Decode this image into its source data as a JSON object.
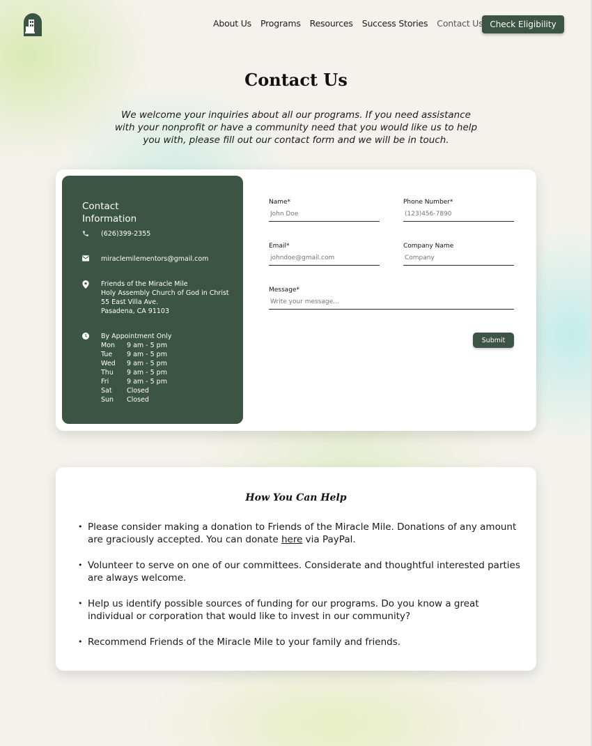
{
  "nav": {
    "items": [
      {
        "label": "About Us",
        "active": false
      },
      {
        "label": "Programs",
        "active": false
      },
      {
        "label": "Resources",
        "active": false
      },
      {
        "label": "Success Stories",
        "active": false
      },
      {
        "label": "Contact Us",
        "active": true
      }
    ],
    "cta_label": "Check Eligibility",
    "logo_icon": "house-arch-logo"
  },
  "page": {
    "title": "Contact Us",
    "intro": "We welcome your inquiries about all our programs. If you need assistance with your nonprofit or have a community need that you would like us to help you with, please fill out our contact form and we will be in touch."
  },
  "contact_info": {
    "title": "Contact Information",
    "phone": "(626)399-2355",
    "email": "miraclemilementors@gmail.com",
    "address": [
      "Friends of the Miracle Mile",
      "Holy Assembly Church of God in Christ",
      "55 East Villa Ave.",
      "Pasadena, CA 91103"
    ],
    "hours_heading": "By Appointment Only",
    "hours": [
      {
        "day": "Mon",
        "time": "9 am - 5 pm"
      },
      {
        "day": "Tue",
        "time": "9 am - 5 pm"
      },
      {
        "day": "Wed",
        "time": "9 am - 5 pm"
      },
      {
        "day": "Thu",
        "time": "9 am - 5 pm"
      },
      {
        "day": "Fri",
        "time": "9 am - 5 pm"
      },
      {
        "day": "Sat",
        "time": "Closed"
      },
      {
        "day": "Sun",
        "time": "Closed"
      }
    ],
    "icons": [
      "phone-icon",
      "mail-icon",
      "location-pin-icon",
      "clock-icon"
    ]
  },
  "form": {
    "name_label": "Name*",
    "name_placeholder": "John Doe",
    "phone_label": "Phone Number*",
    "phone_placeholder": "(123)456-7890",
    "email_label": "Email*",
    "email_placeholder": "johndoe@gmail.com",
    "company_label": "Company Name",
    "company_placeholder": "Company",
    "message_label": "Message*",
    "message_placeholder": "Write your message...",
    "submit_label": "Submit"
  },
  "help": {
    "title": "How You Can Help",
    "item1_before": "Please consider making a donation to Friends of the Miracle Mile.  Donations of any amount are graciously accepted. You can donate ",
    "item1_link": "here",
    "item1_after": " via PayPal.",
    "item2": "Volunteer to serve on one of our committees.  Considerate and thoughtful interested parties are always welcome.",
    "item3": "Help us identify possible sources of funding for our programs.  Do you know a great individual or corporation that would like to invest in our community?",
    "item4": "Recommend Friends of the Miracle Mile to your family and friends."
  },
  "colors": {
    "brand_green": "#3b5443",
    "background": "#f4f2ec"
  }
}
